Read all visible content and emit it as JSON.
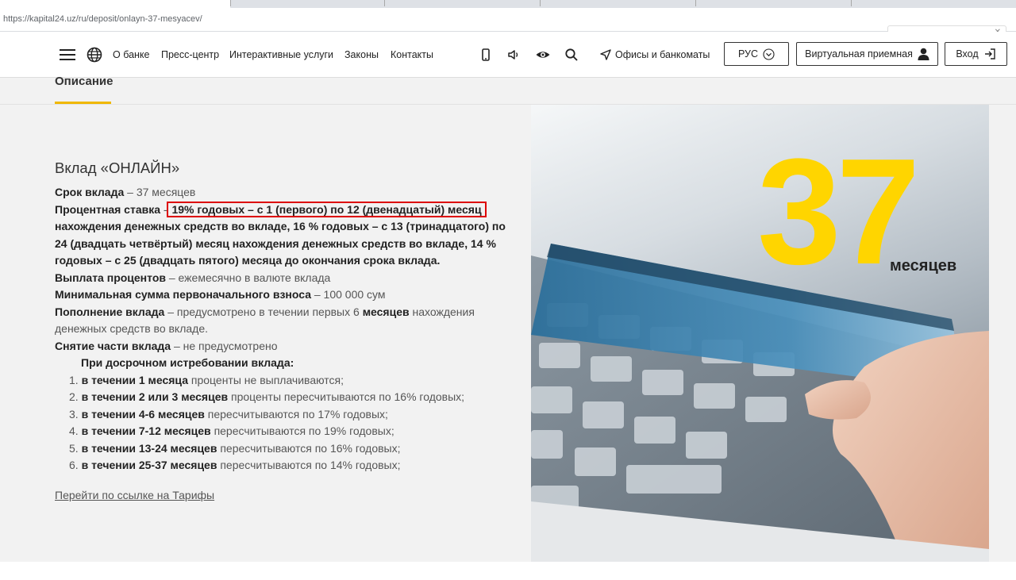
{
  "browser": {
    "url": "https://kapital24.uz/ru/deposit/onlayn-37-mesyacev/"
  },
  "header": {
    "nav": [
      "О банке",
      "Пресс-центр",
      "Интерактивные услуги",
      "Законы",
      "Контакты"
    ],
    "offices_label": "Офисы и банкоматы",
    "lang_label": "РУС",
    "reception_label": "Виртуальная приемная",
    "login_label": "Вход",
    "icons": [
      "hamburger-icon",
      "globe-icon",
      "mobile-icon",
      "sound-icon",
      "eye-icon",
      "search-icon",
      "location-arrow-icon",
      "chevron-down-icon",
      "user-icon",
      "login-icon"
    ]
  },
  "tab": {
    "label": "Описание",
    "accent_color": "#f0b800"
  },
  "deposit": {
    "title": "Вклад «ОНЛАЙН»",
    "term_label": "Срок вклада",
    "term_value": "– 37 месяцев",
    "rate_label": "Процентная ставка",
    "rate_dash": "-",
    "rate_highlight": "19% годовых – с 1 (первого) по 12 (двенадцатый) месяц",
    "rate_rest": "нахождения денежных средств во вкладе, 16 % годовых – с 13 (тринадцатого) по 24 (двадцать четвёртый) месяц нахождения денежных средств во вкладе, 14 % годовых – с 25 (двадцать пятого) месяца до окончания срока вклада.",
    "payout_label": "Выплата процентов",
    "payout_value": "– ежемесячно в валюте вклада",
    "min_label": "Минимальная сумма первоначального взноса",
    "min_value": "– 100 000 сум",
    "topup_label": "Пополнение вклада",
    "topup_value1": "– предусмотрено в течении первых 6",
    "topup_bold": "месяцев",
    "topup_value2": "нахождения денежных средств во вкладе.",
    "withdraw_label": "Снятие части вклада",
    "withdraw_value": "– не предусмотрено",
    "early_heading": "При досрочном истребовании вклада:",
    "early_terms": [
      {
        "num": "1.",
        "bold": "в течении 1 месяца",
        "text": "проценты не выплачиваются;"
      },
      {
        "num": "2.",
        "bold": "в течении 2 или 3 месяцев",
        "text": "проценты пересчитываются по 16% годовых;"
      },
      {
        "num": "3.",
        "bold": "в течении 4-6 месяцев",
        "text": "пересчитываются по 17% годовых;"
      },
      {
        "num": "4.",
        "bold": "в течении 7-12 месяцев",
        "text": "пересчитываются по 19% годовых;"
      },
      {
        "num": "5.",
        "bold": "в течении 13-24 месяцев",
        "text": "пересчитываются по 16% годовых;"
      },
      {
        "num": "6.",
        "bold": "в течении 25-37 месяцев",
        "text": "пересчитываются по 14% годовых;"
      }
    ],
    "tariff_link": "Перейти по ссылке на Тарифы",
    "highlight_color": "#dd0000"
  },
  "hero": {
    "number": "37",
    "unit": "месяцев",
    "number_color": "#ffd500"
  }
}
